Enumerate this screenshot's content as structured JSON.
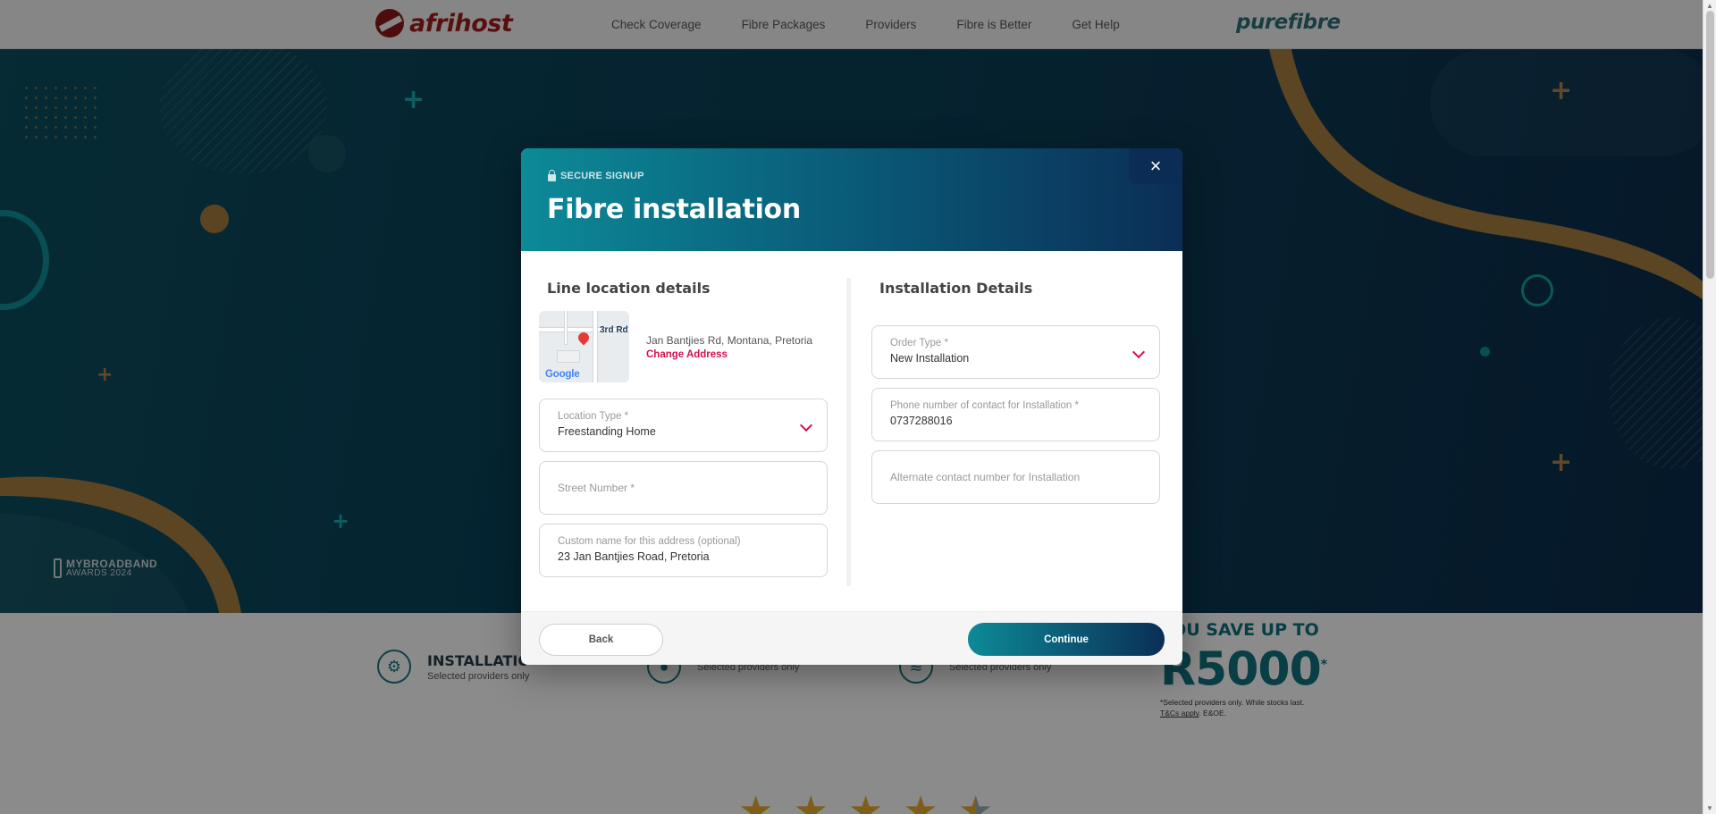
{
  "header": {
    "logo_text": "afrihost",
    "nav": [
      "Check Coverage",
      "Fibre Packages",
      "Providers",
      "Fibre is Better",
      "Get Help"
    ],
    "brand_right": "purefibre"
  },
  "hero": {
    "award_line1": "MYBROADBAND",
    "award_line2": "AWARDS 2024"
  },
  "features": [
    {
      "title": "INSTALLATIO",
      "subtitle": "Selected providers only",
      "icon": "gear-icon"
    },
    {
      "title": "",
      "subtitle": "Selected providers only",
      "icon": "bulb-icon"
    },
    {
      "title": "",
      "subtitle": "Selected providers only",
      "icon": "wifi-icon"
    }
  ],
  "promo": {
    "line1": "YOU SAVE UP TO",
    "amount": "R5000",
    "asterisk": "*",
    "fine1": "*Selected providers only. While stocks last.",
    "fine_link": "T&Cs apply",
    "fine2": ". E&OE."
  },
  "stars": {
    "rating": 4.5,
    "out_of": 5
  },
  "modal": {
    "secure_label": "SECURE SIGNUP",
    "title": "Fibre installation",
    "close_icon": "×",
    "left": {
      "section_title": "Line location details",
      "map_road_label": "3rd Rd",
      "map_google": "Google",
      "address": "Jan Bantjies Rd, Montana, Pretoria",
      "change_address": "Change Address",
      "location_type": {
        "label": "Location Type *",
        "value": "Freestanding Home"
      },
      "street_number": {
        "label": "Street Number *",
        "value": ""
      },
      "custom_name": {
        "label": "Custom name for this address (optional)",
        "value": "23 Jan Bantjies Road, Pretoria"
      }
    },
    "right": {
      "section_title": "Installation Details",
      "order_type": {
        "label": "Order Type *",
        "value": "New Installation"
      },
      "phone": {
        "label": "Phone number of contact for Installation *",
        "value": "0737288016"
      },
      "alt_phone": {
        "label": "Alternate contact number for Installation",
        "value": ""
      }
    },
    "back_label": "Back",
    "continue_label": "Continue"
  },
  "colors": {
    "accent": "#0d8a97",
    "navy": "#0b2e56",
    "highlight": "#d4124e",
    "brand_red": "#9a1c1c"
  }
}
